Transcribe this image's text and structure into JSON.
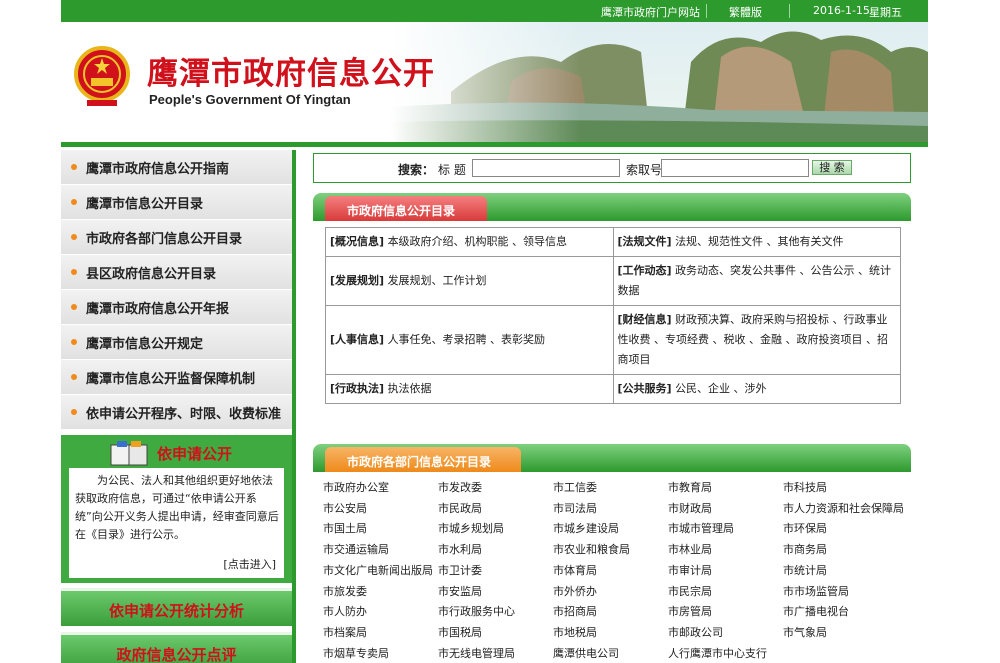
{
  "topbar": {
    "portal": "鹰潭市政府门户网站",
    "traditional": "繁體版",
    "date": "2016-1-15",
    "weekday": "星期五"
  },
  "banner": {
    "title_cn": "鹰潭市政府信息公开",
    "title_en": "People's Government Of Yingtan"
  },
  "leftnav": [
    "鹰潭市政府信息公开指南",
    "鹰潭市信息公开目录",
    "市政府各部门信息公开目录",
    "县区政府信息公开目录",
    "鹰潭市政府信息公开年报",
    "鹰潭市信息公开规定",
    "鹰潭市信息公开监督保障机制",
    "依申请公开程序、时限、收费标准"
  ],
  "apply": {
    "title": "依申请公开",
    "text": "为公民、法人和其他组织更好地依法获取政府信息，可通过“依申请公开系统”向公开义务人提出申请，经审查同意后在《目录》进行公示。",
    "more": "[点击进入]"
  },
  "buttons": {
    "stats": "依申请公开统计分析",
    "review": "政府信息公开点评"
  },
  "search": {
    "label": "搜索：",
    "title_label": "标 题",
    "index_label": "索取号",
    "button": "搜 索"
  },
  "catalog": {
    "heading": "市政府信息公开目录",
    "rows": [
      [
        {
          "tag": "[概况信息]",
          "text": "本级政府介绍、机构职能 、领导信息"
        },
        {
          "tag": "[法规文件]",
          "text": "法规、规范性文件 、其他有关文件"
        }
      ],
      [
        {
          "tag": "[发展规划]",
          "text": "发展规划、工作计划"
        },
        {
          "tag": "[工作动态]",
          "text": "政务动态、突发公共事件 、公告公示 、统计数据"
        }
      ],
      [
        {
          "tag": "[人事信息]",
          "text": "人事任免、考录招聘 、表彰奖励"
        },
        {
          "tag": "[财经信息]",
          "text": "财政预决算、政府采购与招投标 、行政事业性收费 、专项经费 、税收 、金融 、政府投资项目 、招商项目"
        }
      ],
      [
        {
          "tag": "[行政执法]",
          "text": "执法依据"
        },
        {
          "tag": "[公共服务]",
          "text": "公民、企业 、涉外"
        }
      ]
    ]
  },
  "departments": {
    "heading": "市政府各部门信息公开目录",
    "items": [
      "市政府办公室",
      "市发改委",
      "市工信委",
      "市教育局",
      "市科技局",
      "市公安局",
      "市民政局",
      "市司法局",
      "市财政局",
      "市人力资源和社会保障局",
      "市国土局",
      "市城乡规划局",
      "市城乡建设局",
      "市城市管理局",
      "市环保局",
      "市交通运输局",
      "市水利局",
      "市农业和粮食局",
      "市林业局",
      "市商务局",
      "市文化广电新闻出版局",
      "市卫计委",
      "市体育局",
      "市审计局",
      "市统计局",
      "市旅发委",
      "市安监局",
      "市外侨办",
      "市民宗局",
      "市市场监管局",
      "市人防办",
      "市行政服务中心",
      "市招商局",
      "市房管局",
      "市广播电视台",
      "市档案局",
      "市国税局",
      "市地税局",
      "市邮政公司",
      "市气象局",
      "市烟草专卖局",
      "市无线电管理局",
      "鹰潭供电公司",
      "人行鹰潭市中心支行",
      ""
    ]
  },
  "colors": {
    "green": "#2d9a2d",
    "red": "#d0101a",
    "orange": "#ee8a1a"
  }
}
